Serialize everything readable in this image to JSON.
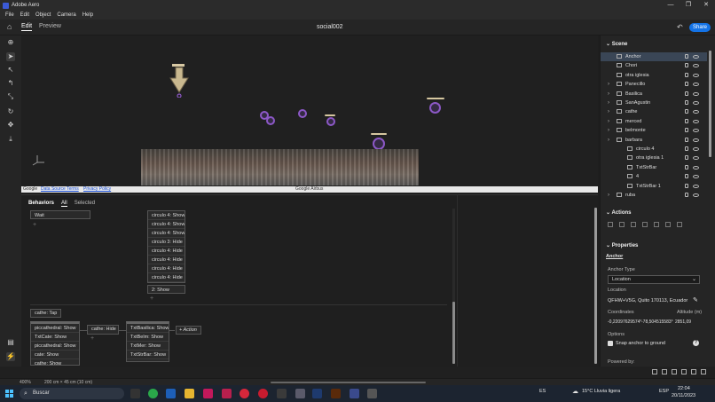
{
  "window": {
    "title": "Adobe Aero",
    "controls": [
      "—",
      "❐",
      "✕"
    ]
  },
  "menu": [
    "File",
    "Edit",
    "Object",
    "Camera",
    "Help"
  ],
  "toolbar": {
    "tab_edit": "Edit",
    "tab_preview": "Preview",
    "doc_title": "social002",
    "share_label": "Share"
  },
  "viewport_footer": {
    "google": "Google",
    "data_source": "Data Source Terms",
    "privacy": "Privacy Policy",
    "airbus": "Google Airbus"
  },
  "behaviors": {
    "tabs": {
      "title": "Behaviors",
      "all": "All",
      "selected": "Selected"
    },
    "wait_label": "Wait",
    "column1": [
      "circulo 4: Show",
      "circulo 4: Show",
      "circulo 4: Show",
      "circulo 3: Hide",
      "circulo 4: Hide",
      "circulo 4: Hide",
      "circulo 4: Hide",
      "circulo 4: Hide"
    ],
    "show2": "2: Show",
    "trigger": "cathe: Tap",
    "group_a": [
      "piccathedral: Show",
      "TxtCate: Show",
      "piccathedral: Show",
      "cate: Show",
      "cathe: Show"
    ],
    "cathe_hide": "cathe: Hide",
    "group_b": [
      "TxtBasilica: Show",
      "TxtBelm: Show",
      "TxtMer: Show",
      "TxtStrBar: Show"
    ],
    "action": "+ Action"
  },
  "scene": {
    "title": "Scene",
    "items": [
      {
        "label": "Anchor",
        "selected": true,
        "expand": false,
        "indent": 0
      },
      {
        "label": "Chori",
        "expand": false,
        "indent": 0
      },
      {
        "label": "otra iglesia",
        "expand": false,
        "indent": 0
      },
      {
        "label": "Panecillo",
        "expand": true,
        "indent": 0
      },
      {
        "label": "Basilica",
        "expand": true,
        "indent": 0
      },
      {
        "label": "SanAgustin",
        "expand": true,
        "indent": 0
      },
      {
        "label": "cathe",
        "expand": true,
        "indent": 0
      },
      {
        "label": "merced",
        "expand": true,
        "indent": 0
      },
      {
        "label": "belmonte",
        "expand": true,
        "indent": 0
      },
      {
        "label": "barbara",
        "expand": true,
        "indent": 0
      },
      {
        "label": "circulo 4",
        "expand": false,
        "indent": 1
      },
      {
        "label": "otra iglesia 1",
        "expand": false,
        "indent": 1
      },
      {
        "label": "TxtStrBar",
        "expand": false,
        "indent": 1
      },
      {
        "label": "4",
        "expand": false,
        "indent": 1
      },
      {
        "label": "TxtStrBar 1",
        "expand": false,
        "indent": 1
      },
      {
        "label": "ruba",
        "expand": true,
        "indent": 0
      }
    ]
  },
  "actions_title": "Actions",
  "properties": {
    "title": "Properties",
    "object": "Anchor",
    "anchor_type_label": "Anchor Type",
    "anchor_type": "Location",
    "location_label": "Location",
    "location": "QFHW+V5G, Quito 170113, Ecuador",
    "coordinates_label": "Coordinates",
    "altitude_label": "Altitude (m)",
    "lat": "-0,22097629574°",
    "lon": "-78,504515583°",
    "altitude": "2851,09",
    "options_label": "Options",
    "snap_label": "Snap anchor to ground",
    "powered_by": "Powered by:"
  },
  "statusbar": {
    "zoom": "400%",
    "size": "200 cm × 45 cm (10 cm)"
  },
  "taskbar": {
    "search": "Buscar",
    "weather": "15°C  Lluvia ligera",
    "lang": "ESP",
    "es": "ES",
    "time": "22:04",
    "date": "20/11/2023"
  },
  "colors": {
    "accent": "#1473e6",
    "marker": "#8c58c6",
    "selected_row": "#3a4656"
  }
}
